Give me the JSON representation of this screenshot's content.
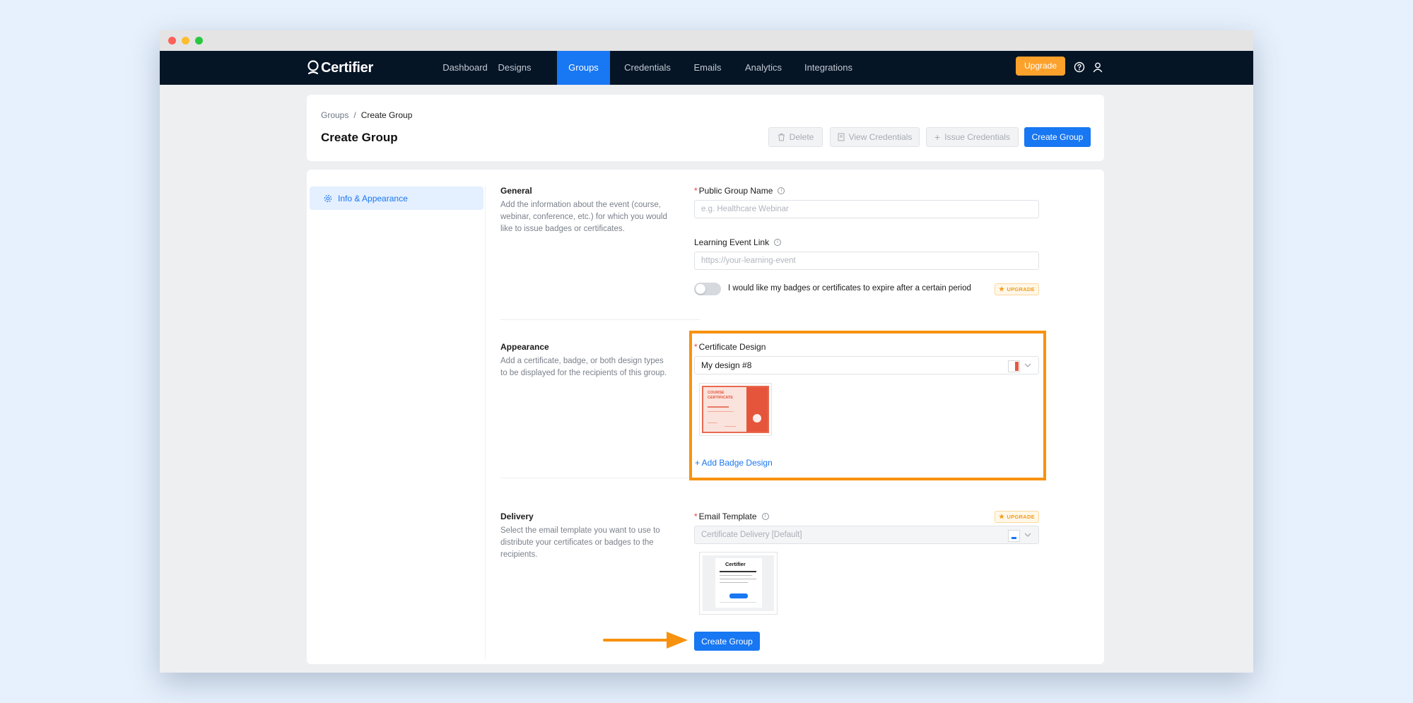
{
  "brand": {
    "name": "Certifier"
  },
  "nav": {
    "items": [
      {
        "label": "Dashboard"
      },
      {
        "label": "Designs"
      },
      {
        "label": "Groups"
      },
      {
        "label": "Credentials"
      },
      {
        "label": "Emails"
      },
      {
        "label": "Analytics"
      },
      {
        "label": "Integrations"
      }
    ],
    "active": "Groups",
    "upgrade_label": "Upgrade"
  },
  "header": {
    "breadcrumb": {
      "root": "Groups",
      "separator": "/",
      "current": "Create Group"
    },
    "title": "Create Group",
    "actions": {
      "delete": "Delete",
      "view_credentials": "View Credentials",
      "issue_credentials": "Issue Credentials",
      "create_group": "Create Group"
    }
  },
  "sidebar": {
    "items": [
      {
        "label": "Info & Appearance",
        "icon": "gear-icon"
      }
    ]
  },
  "general": {
    "title": "General",
    "description": "Add the information about the event (course, webinar, conference, etc.) for which you would like to issue badges or certificates.",
    "group_name_label": "Public Group Name",
    "group_name_placeholder": "e.g. Healthcare Webinar",
    "event_link_label": "Learning Event Link",
    "event_link_placeholder": "https://your-learning-event",
    "expire_toggle_label": "I would like my badges or certificates to expire after a certain period",
    "expire_toggle_on": false,
    "upgrade_badge": "UPGRADE"
  },
  "appearance": {
    "title": "Appearance",
    "description": "Add a certificate, badge, or both design types to be displayed for the recipients of this group.",
    "certificate_design_label": "Certificate Design",
    "certificate_design_value": "My design #8",
    "thumbnail": {
      "line1": "COURSE",
      "line2": "CERTIFICATE"
    },
    "add_badge_link": "+ Add Badge Design"
  },
  "delivery": {
    "title": "Delivery",
    "description": "Select the email template you want to use to distribute your certificates or badges to the recipients.",
    "email_template_label": "Email Template",
    "email_template_value": "Certificate Delivery [Default]",
    "upgrade_badge": "UPGRADE"
  },
  "footer": {
    "create_group": "Create Group"
  },
  "colors": {
    "accent": "#1877f2",
    "nav_bg": "#051526",
    "upgrade": "#fca12b",
    "highlight": "#f7920f"
  }
}
